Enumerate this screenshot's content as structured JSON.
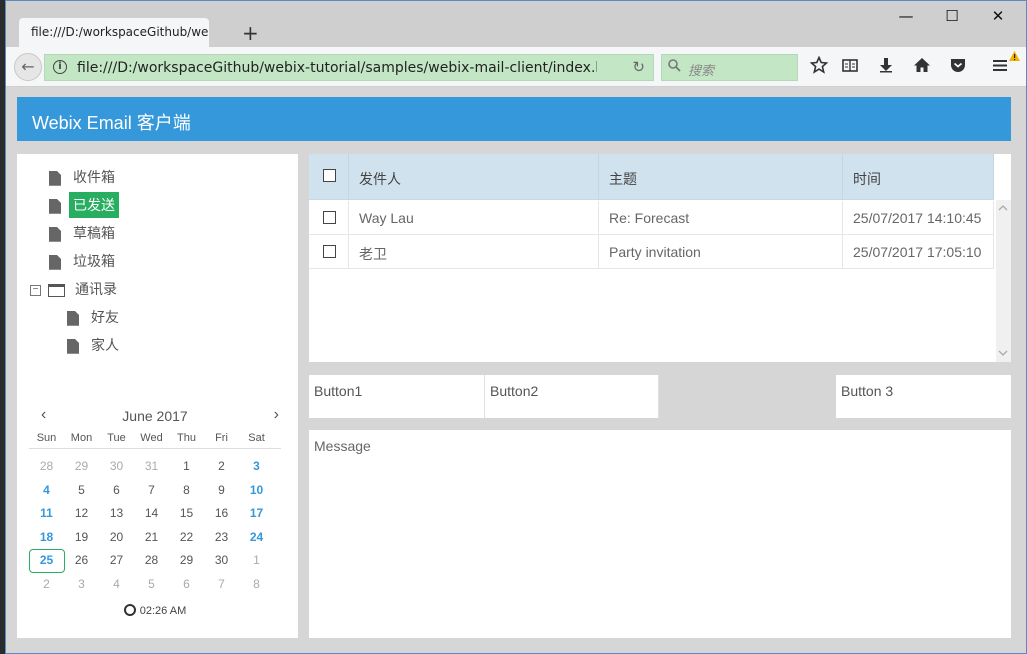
{
  "browser": {
    "tab_title": "file:///D:/workspaceGithub/webix-tutorial/samples/webix-mail-client/index.html",
    "tab_close": "×",
    "new_tab": "+",
    "minimize": "—",
    "maximize": "☐",
    "close": "✕",
    "back": "←",
    "info": "i",
    "url": "file:///D:/workspaceGithub/webix-tutorial/samples/webix-mail-client/index.html",
    "reload": "↻",
    "search_placeholder": "搜索",
    "icons": [
      "star-icon",
      "reading-list-icon",
      "download-icon",
      "home-icon",
      "pocket-icon",
      "menu-icon"
    ]
  },
  "app": {
    "title": "Webix Email 客户端"
  },
  "tree": {
    "items": [
      {
        "label": "收件箱",
        "selected": false
      },
      {
        "label": "已发送",
        "selected": true
      },
      {
        "label": "草稿箱",
        "selected": false
      },
      {
        "label": "垃圾箱",
        "selected": false
      }
    ],
    "folder": {
      "label": "通讯录",
      "toggle": "−",
      "children": [
        "好友",
        "家人"
      ]
    }
  },
  "calendar": {
    "month": "June 2017",
    "prev": "‹",
    "next": "›",
    "days": [
      "Sun",
      "Mon",
      "Tue",
      "Wed",
      "Thu",
      "Fri",
      "Sat"
    ],
    "weeks": [
      [
        "28",
        "29",
        "30",
        "31",
        "1",
        "2",
        "3"
      ],
      [
        "4",
        "5",
        "6",
        "7",
        "8",
        "9",
        "10"
      ],
      [
        "11",
        "12",
        "13",
        "14",
        "15",
        "16",
        "17"
      ],
      [
        "18",
        "19",
        "20",
        "21",
        "22",
        "23",
        "24"
      ],
      [
        "25",
        "26",
        "27",
        "28",
        "29",
        "30",
        "1"
      ],
      [
        "2",
        "3",
        "4",
        "5",
        "6",
        "7",
        "8"
      ]
    ],
    "today": "25",
    "time": "02:26 AM"
  },
  "grid": {
    "columns": [
      "发件人",
      "主题",
      "时间"
    ],
    "rows": [
      {
        "from": "Way Lau",
        "subject": "Re: Forecast",
        "date": "25/07/2017 14:10:45"
      },
      {
        "from": "老卫",
        "subject": "Party invitation",
        "date": "25/07/2017 17:05:10"
      }
    ]
  },
  "buttons": {
    "b1": "Button1",
    "b2": "Button2",
    "b3": "Button 3"
  },
  "message": {
    "label": "Message"
  },
  "colors": {
    "header": "#3498db",
    "selected": "#27ae60",
    "grid_header": "#d1e2ef",
    "url_bar": "#c3e6c5"
  }
}
